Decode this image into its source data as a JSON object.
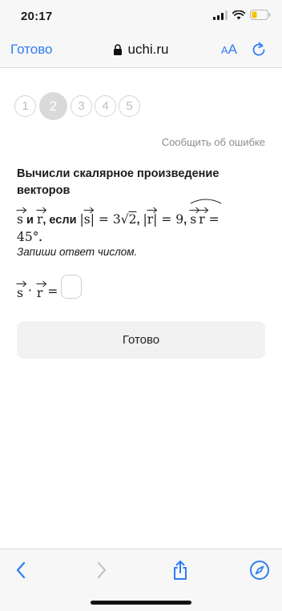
{
  "status": {
    "time": "20:17"
  },
  "nav": {
    "done_label": "Готово",
    "url": "uchi.ru",
    "aa_small": "A",
    "aa_big": "A"
  },
  "steps": [
    "1",
    "2",
    "3",
    "4",
    "5"
  ],
  "active_step": 2,
  "report_link": "Сообщить об ошибке",
  "task": {
    "heading": "Вычисли скалярное произведение векторов",
    "and": " и ",
    "if": ", если ",
    "vec_s": "s",
    "vec_r": "r",
    "abs_s_value": "3",
    "sqrt_arg": "2",
    "abs_r_value": "9",
    "angle_value": "45",
    "degree": "°"
  },
  "instruction": "Запиши ответ числом.",
  "answer": {
    "value": ""
  },
  "done_button": "Готово",
  "colors": {
    "accent": "#2f7cf6",
    "active_step": "#d9d9d9",
    "button_bg": "#f1f1f1"
  },
  "icons": [
    "lock-icon",
    "reload-icon",
    "back-icon",
    "forward-icon",
    "share-icon",
    "compass-icon"
  ]
}
